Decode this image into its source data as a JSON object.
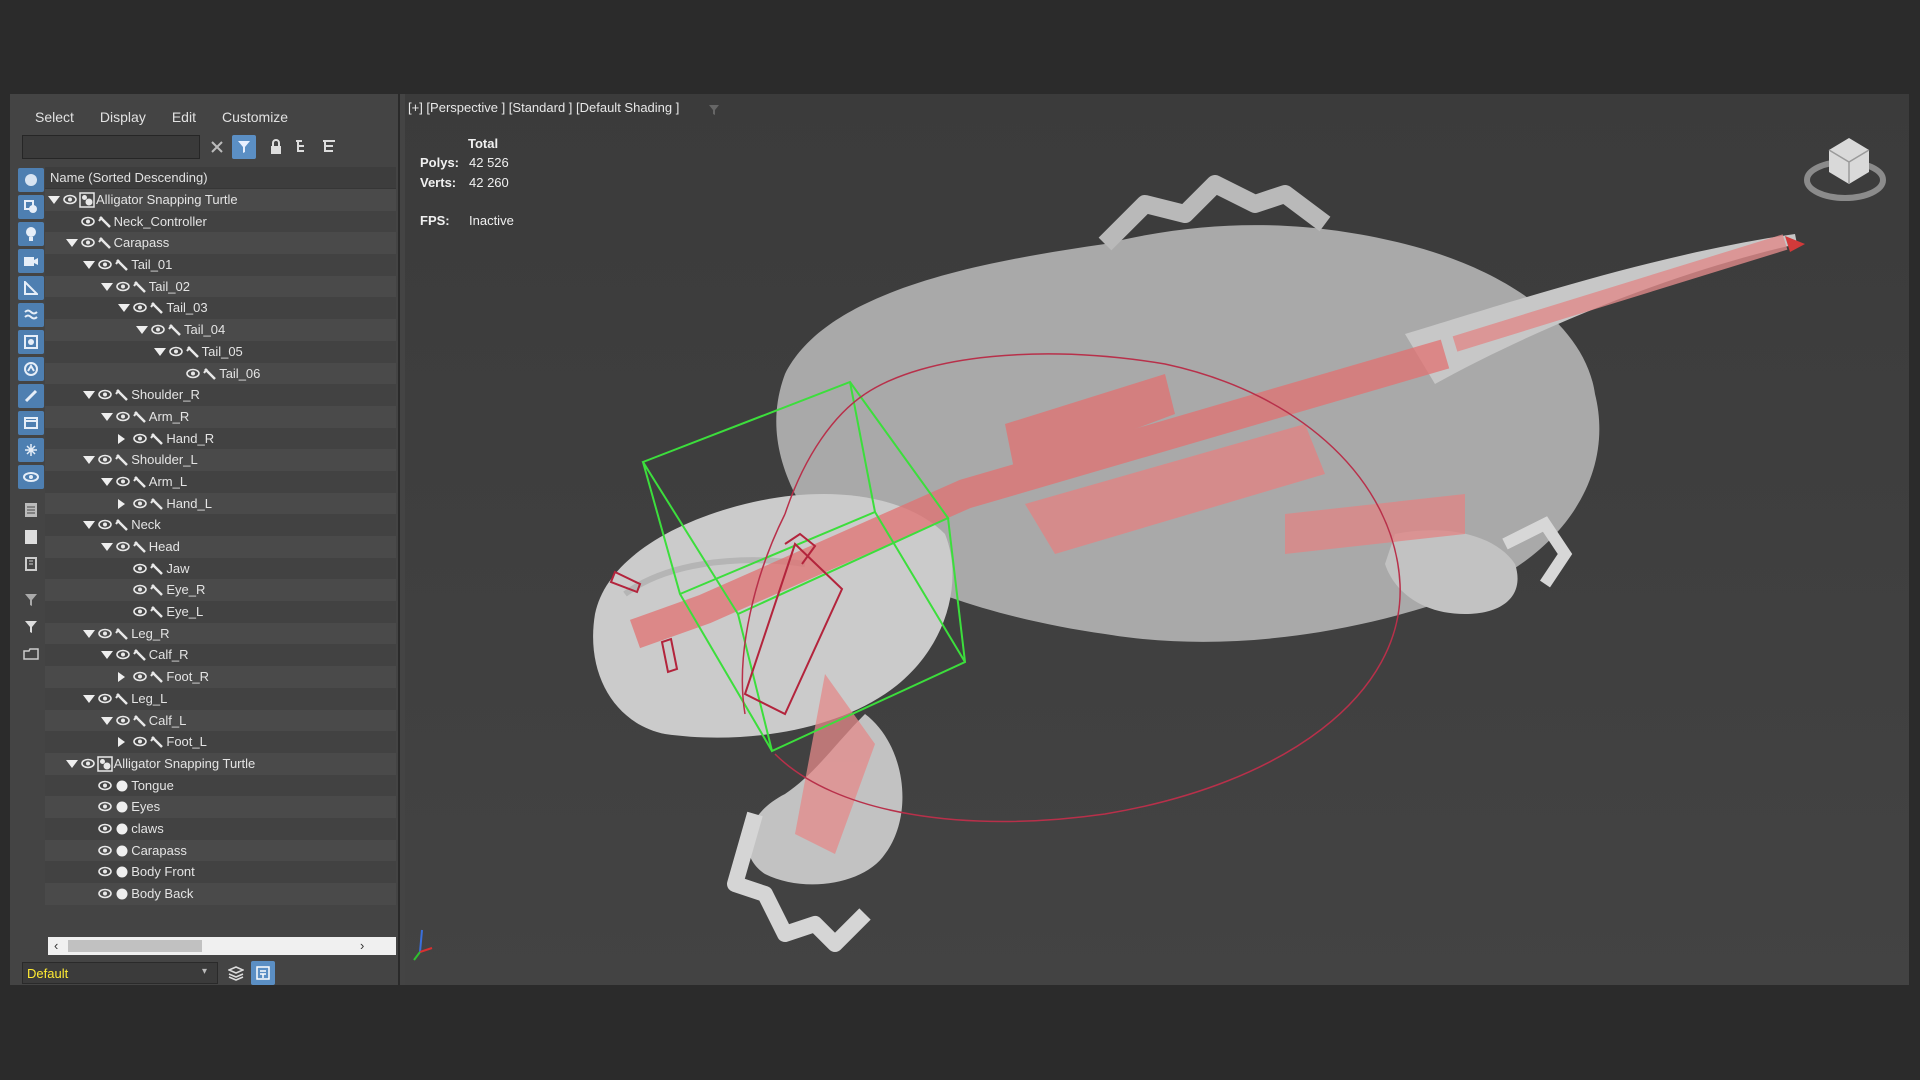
{
  "menu": [
    "Select",
    "Display",
    "Edit",
    "Customize"
  ],
  "search": {
    "value": ""
  },
  "tree_header": "Name (Sorted Descending)",
  "tree": [
    {
      "label": "Alligator Snapping Turtle",
      "depth": 0,
      "arrow": "down",
      "type": "group"
    },
    {
      "label": "Neck_Controller",
      "depth": 1,
      "arrow": "none",
      "type": "bone"
    },
    {
      "label": "Carapass",
      "depth": 1,
      "arrow": "down",
      "type": "bone"
    },
    {
      "label": "Tail_01",
      "depth": 2,
      "arrow": "down",
      "type": "bone"
    },
    {
      "label": "Tail_02",
      "depth": 3,
      "arrow": "down",
      "type": "bone"
    },
    {
      "label": "Tail_03",
      "depth": 4,
      "arrow": "down",
      "type": "bone"
    },
    {
      "label": "Tail_04",
      "depth": 5,
      "arrow": "down",
      "type": "bone"
    },
    {
      "label": "Tail_05",
      "depth": 6,
      "arrow": "down",
      "type": "bone"
    },
    {
      "label": "Tail_06",
      "depth": 7,
      "arrow": "none",
      "type": "bone"
    },
    {
      "label": "Shoulder_R",
      "depth": 2,
      "arrow": "down",
      "type": "bone"
    },
    {
      "label": "Arm_R",
      "depth": 3,
      "arrow": "down",
      "type": "bone"
    },
    {
      "label": "Hand_R",
      "depth": 4,
      "arrow": "right",
      "type": "bone"
    },
    {
      "label": "Shoulder_L",
      "depth": 2,
      "arrow": "down",
      "type": "bone"
    },
    {
      "label": "Arm_L",
      "depth": 3,
      "arrow": "down",
      "type": "bone"
    },
    {
      "label": "Hand_L",
      "depth": 4,
      "arrow": "right",
      "type": "bone"
    },
    {
      "label": "Neck",
      "depth": 2,
      "arrow": "down",
      "type": "bone"
    },
    {
      "label": "Head",
      "depth": 3,
      "arrow": "down",
      "type": "bone"
    },
    {
      "label": "Jaw",
      "depth": 4,
      "arrow": "none",
      "type": "bone"
    },
    {
      "label": "Eye_R",
      "depth": 4,
      "arrow": "none",
      "type": "bone"
    },
    {
      "label": "Eye_L",
      "depth": 4,
      "arrow": "none",
      "type": "bone"
    },
    {
      "label": "Leg_R",
      "depth": 2,
      "arrow": "down",
      "type": "bone"
    },
    {
      "label": "Calf_R",
      "depth": 3,
      "arrow": "down",
      "type": "bone"
    },
    {
      "label": "Foot_R",
      "depth": 4,
      "arrow": "right",
      "type": "bone"
    },
    {
      "label": "Leg_L",
      "depth": 2,
      "arrow": "down",
      "type": "bone"
    },
    {
      "label": "Calf_L",
      "depth": 3,
      "arrow": "down",
      "type": "bone"
    },
    {
      "label": "Foot_L",
      "depth": 4,
      "arrow": "right",
      "type": "bone"
    },
    {
      "label": "Alligator Snapping Turtle",
      "depth": 1,
      "arrow": "down",
      "type": "group"
    },
    {
      "label": "Tongue",
      "depth": 2,
      "arrow": "none",
      "type": "mesh"
    },
    {
      "label": "Eyes",
      "depth": 2,
      "arrow": "none",
      "type": "mesh"
    },
    {
      "label": "claws",
      "depth": 2,
      "arrow": "none",
      "type": "mesh"
    },
    {
      "label": "Carapass",
      "depth": 2,
      "arrow": "none",
      "type": "mesh"
    },
    {
      "label": "Body Front",
      "depth": 2,
      "arrow": "none",
      "type": "mesh"
    },
    {
      "label": "Body Back",
      "depth": 2,
      "arrow": "none",
      "type": "mesh"
    }
  ],
  "layer": {
    "value": "Default"
  },
  "viewport": {
    "label": "[+] [Perspective ] [Standard ] [Default Shading ]",
    "stats": {
      "total": "Total",
      "polys_label": "Polys:",
      "polys": "42 526",
      "verts_label": "Verts:",
      "verts": "42 260",
      "fps_label": "FPS:",
      "fps": "Inactive"
    }
  },
  "colors": {
    "accent": "#5b8fc4",
    "layer_text": "#ffeb33",
    "bbox": "#3cde3c",
    "bone": "#e06464"
  }
}
